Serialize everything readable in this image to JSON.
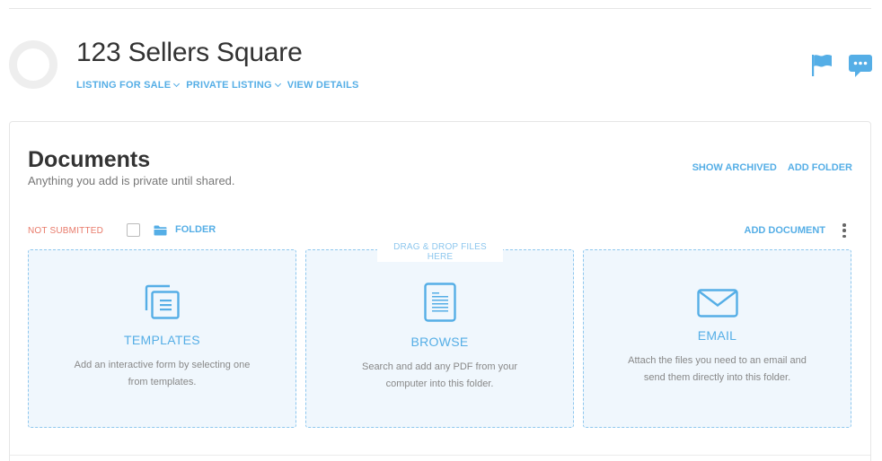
{
  "header": {
    "title": "123 Sellers Square",
    "links": [
      {
        "label": "LISTING FOR SALE",
        "has_dropdown": true
      },
      {
        "label": "PRIVATE LISTING",
        "has_dropdown": true
      },
      {
        "label": "VIEW DETAILS",
        "has_dropdown": false
      }
    ],
    "icons": [
      "flag-icon",
      "chat-icon"
    ]
  },
  "documents": {
    "title": "Documents",
    "subtitle": "Anything you add is private until shared.",
    "show_archived": "SHOW ARCHIVED",
    "add_folder": "ADD FOLDER",
    "folder_row": {
      "status": "NOT SUBMITTED",
      "folder_label": "FOLDER",
      "add_document": "ADD DOCUMENT"
    },
    "drag_drop": "DRAG & DROP FILES HERE",
    "cards": [
      {
        "title": "TEMPLATES",
        "desc": "Add an interactive form by selecting one from templates.",
        "icon": "templates-icon"
      },
      {
        "title": "BROWSE",
        "desc": "Search and add any PDF from your computer into this folder.",
        "icon": "document-icon"
      },
      {
        "title": "EMAIL",
        "desc": "Attach the files you need to an email and send them directly into this folder.",
        "icon": "envelope-icon"
      }
    ]
  },
  "colors": {
    "accent": "#55aee6",
    "status": "#e87a6a",
    "card_bg": "#f0f7fd",
    "card_border": "#8ec7ee"
  }
}
